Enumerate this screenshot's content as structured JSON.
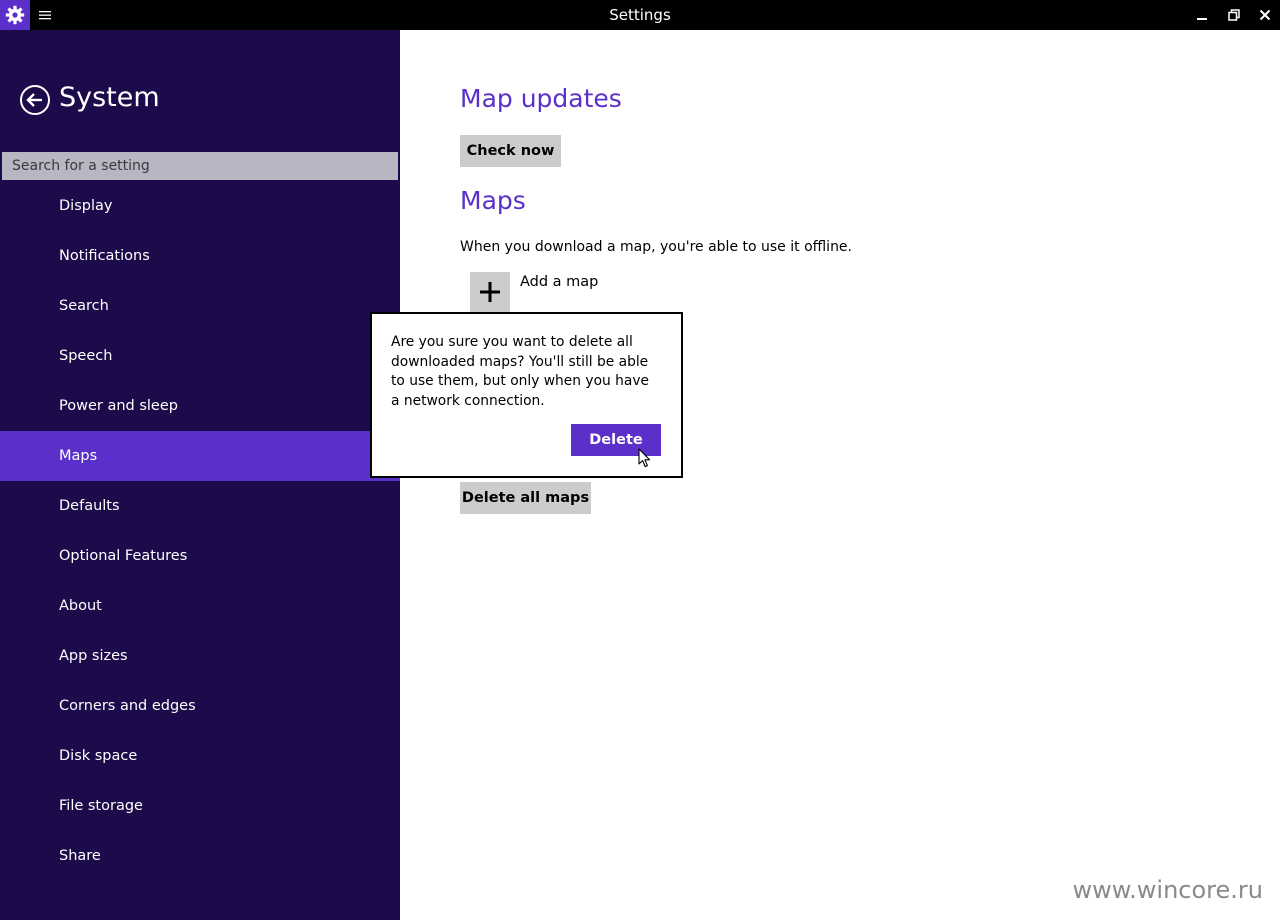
{
  "window": {
    "title": "Settings",
    "accent_color": "#5b2fc9",
    "icons": {
      "app": "gear-icon",
      "menu": "hamburger-menu-icon",
      "minimize": "minimize-icon",
      "restore": "restore-icon",
      "close": "close-icon"
    }
  },
  "sidebar": {
    "title": "System",
    "back_icon": "back-arrow-icon",
    "background_color": "#1c0a4a",
    "search_placeholder": "Search for a setting",
    "items": [
      {
        "label": "Display"
      },
      {
        "label": "Notifications"
      },
      {
        "label": "Search"
      },
      {
        "label": "Speech"
      },
      {
        "label": "Power and sleep"
      },
      {
        "label": "Maps",
        "selected": true
      },
      {
        "label": "Defaults"
      },
      {
        "label": "Optional Features"
      },
      {
        "label": "About"
      },
      {
        "label": "App sizes"
      },
      {
        "label": "Corners and edges"
      },
      {
        "label": "Disk space"
      },
      {
        "label": "File storage"
      },
      {
        "label": "Share"
      }
    ]
  },
  "main": {
    "map_updates": {
      "heading": "Map updates",
      "check_button": "Check now"
    },
    "maps": {
      "heading": "Maps",
      "description": "When you download a map, you're able to use it offline.",
      "add_icon": "plus-icon",
      "add_label": "Add a map",
      "delete_all_button": "Delete all maps"
    }
  },
  "flyout": {
    "message": "Are you sure you want to delete all downloaded maps? You'll still be able to use them, but only when you have a network connection.",
    "delete_button": "Delete"
  },
  "watermark": "www.wincore.ru"
}
